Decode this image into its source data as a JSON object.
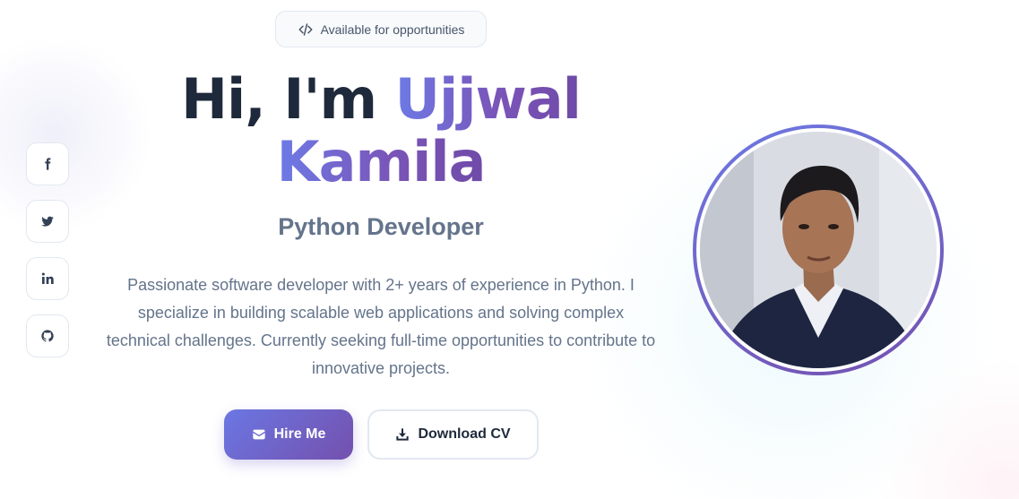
{
  "badge": {
    "icon": "code-icon",
    "text": "Available for opportunities"
  },
  "hero": {
    "greeting": "Hi, I'm",
    "first_name": "Ujjwal",
    "last_name": "Kamila",
    "role": "Python Developer",
    "bio": "Passionate software developer with 2+ years of experience in Python. I specialize in building scalable web applications and solving complex technical challenges. Currently seeking full-time opportunities to contribute to innovative projects."
  },
  "buttons": {
    "hire": {
      "label": "Hire Me",
      "icon": "envelope-icon"
    },
    "cv": {
      "label": "Download CV",
      "icon": "download-icon"
    }
  },
  "socials": [
    {
      "name": "facebook",
      "icon": "facebook-icon"
    },
    {
      "name": "twitter",
      "icon": "twitter-icon"
    },
    {
      "name": "linkedin",
      "icon": "linkedin-icon"
    },
    {
      "name": "github",
      "icon": "github-icon"
    }
  ],
  "colors": {
    "accent_start": "#6d7ae6",
    "accent_end": "#7450ad",
    "heading": "#1e293b",
    "muted": "#64748b"
  }
}
